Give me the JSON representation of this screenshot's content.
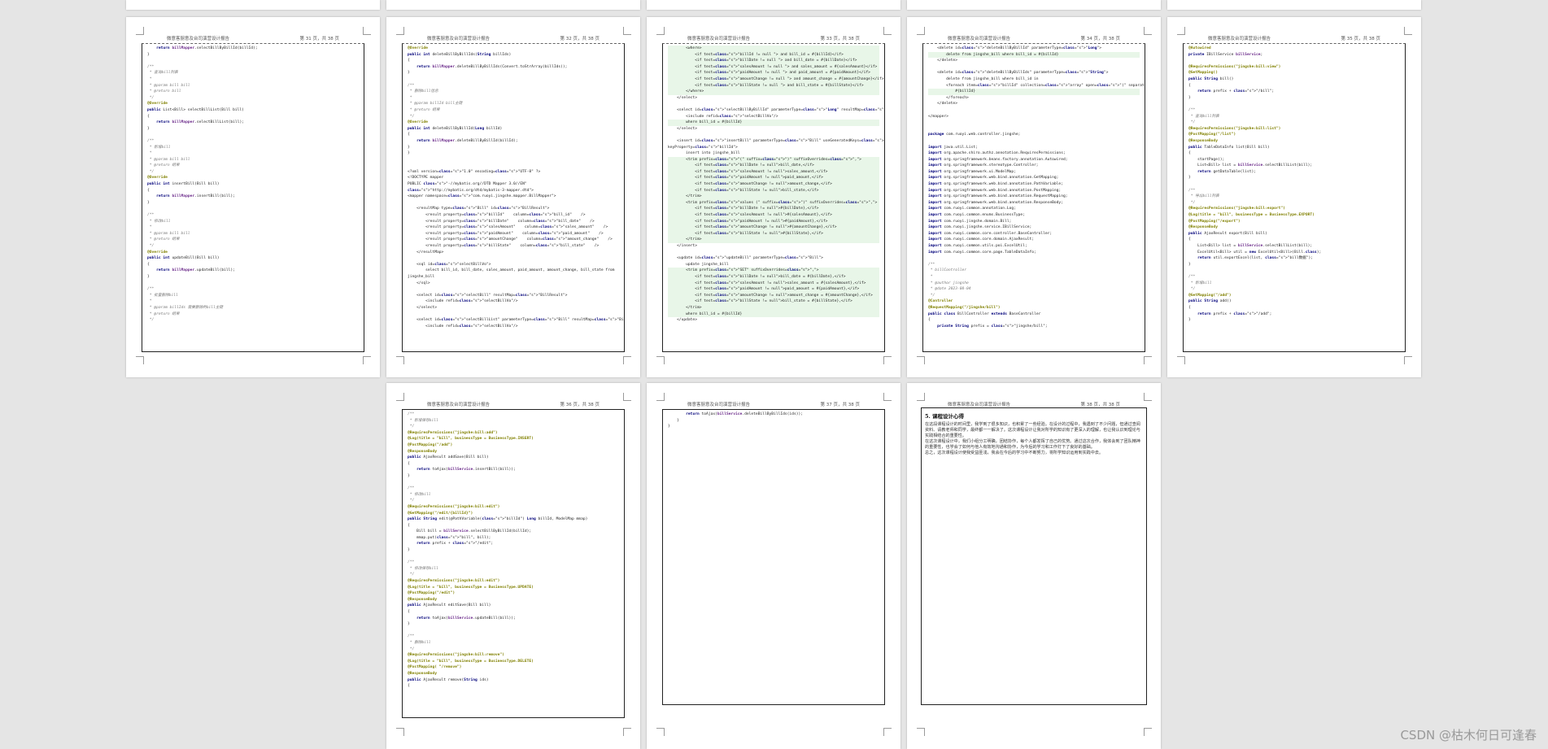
{
  "document": {
    "header_title": "微意客厨意及台司演营设计报告",
    "watermark": "CSDN @枯木何日可逢春"
  },
  "pages": [
    {
      "page_label": "第 31 页，共 38 页",
      "lines": [
        "    return billMapper.selectBillByBillId(billId);",
        "}",
        "",
        "/**",
        " * 查询bill列表",
        " *",
        " * @param bill bill",
        " * @return bill",
        " */",
        "@Override",
        "public List<Bill> selectBillList(Bill bill)",
        "{",
        "    return billMapper.selectBillList(bill);",
        "}",
        "",
        "/**",
        " * 新增bill",
        " *",
        " * @param bill bill",
        " * @return 结果",
        " */",
        "@Override",
        "public int insertBill(Bill bill)",
        "{",
        "    return billMapper.insertBill(bill);",
        "}",
        "",
        "/**",
        " * 修改bill",
        " *",
        " * @param bill bill",
        " * @return 结果",
        " */",
        "@Override",
        "public int updateBill(Bill bill)",
        "{",
        "    return billMapper.updateBill(bill);",
        "}",
        "",
        "/**",
        " * 批量删除bill",
        " *",
        " * @param billIds 需要删除的bill主键",
        " * @return 结果",
        " */"
      ]
    },
    {
      "page_label": "第 32 页，共 38 页",
      "lines": [
        "@Override",
        "public int deleteBillByBillIds(String billIds)",
        "{",
        "    return billMapper.deleteBillByBillIds(Convert.toStrArray(billIds));",
        "}",
        "",
        "/**",
        " * 删除bill信息",
        " *",
        " * @param billId bill主键",
        " * @return 结果",
        " */",
        "@Override",
        "public int deleteBillByBillId(Long billId)",
        "{",
        "    return billMapper.deleteBillByBillId(billId);",
        "}",
        "}",
        "",
        "",
        "<?xml version=\"1.0\" encoding=\"UTF-8\" ?>",
        "<!DOCTYPE mapper",
        "PUBLIC \"-//mybatis.org//DTD Mapper 3.0//EN\"",
        "\"http://mybatis.org/dtd/mybatis-3-mapper.dtd\">",
        "<mapper namespace=\"com.ruoyi.jingshe.mapper.BillMapper\">",
        "",
        "    <resultMap type=\"Bill\" id=\"BillResult\">",
        "        <result property=\"billId\"    column=\"bill_id\"    />",
        "        <result property=\"billDate\"    column=\"bill_date\"    />",
        "        <result property=\"salesAmount\"    column=\"sales_amount\"    />",
        "        <result property=\"paidAmount\"    column=\"paid_amount\"    />",
        "        <result property=\"amountChange\"    column=\"amount_change\"    />",
        "        <result property=\"billState\"    column=\"bill_state\"    />",
        "    </resultMap>",
        "",
        "    <sql id=\"selectBillVo\">",
        "        select bill_id, bill_date, sales_amount, paid_amount, amount_change, bill_state from",
        "jingshe_bill",
        "    </sql>",
        "",
        "    <select id=\"selectBill\" resultMap=\"BillResult\">",
        "        <include refid=\"selectBillVo\"/>",
        "    </select>",
        "",
        "    <select id=\"selectBillList\" parameterType=\"Bill\" resultMap=\"BillResult\">",
        "        <include refid=\"selectBillVo\"/>"
      ]
    },
    {
      "page_label": "第 33 页，共 38 页",
      "lines": [
        "        <where>",
        "            <if test=\"billId != null \"> and bill_id = #{billId}</if>",
        "            <if test=\"billDate != null \"> and bill_date = #{billDate}</if>",
        "            <if test=\"salesAmount != null \"> and sales_amount = #{salesAmount}</if>",
        "            <if test=\"paidAmount != null \"> and paid_amount = #{paidAmount}</if>",
        "            <if test=\"amountChange != null \"> and amount_change = #{amountChange}</if>",
        "            <if test=\"billState != null \"> and bill_state = #{billState}</if>",
        "        </where>",
        "    </select>",
        "",
        "    <select id=\"selectBillByBillId\" parameterType=\"Long\" resultMap=\"BillResult\">",
        "        <include refid=\"selectBillVo\"/>",
        "        where bill_id = #{billId}",
        "    </select>",
        "",
        "    <insert id=\"insertBill\" parameterType=\"Bill\" useGeneratedKeys=\"true\"",
        "keyProperty=\"billId\">",
        "        insert into jingshe_bill",
        "        <trim prefix=\"(\" suffix=\")\" suffixOverrides=\",\">",
        "            <if test=\"billDate != null\">bill_date,</if>",
        "            <if test=\"salesAmount != null\">sales_amount,</if>",
        "            <if test=\"paidAmount != null\">paid_amount,</if>",
        "            <if test=\"amountChange != null\">amount_change,</if>",
        "            <if test=\"billState != null\">bill_state,</if>",
        "        </trim>",
        "        <trim prefix=\"values (\" suffix=\")\" suffixOverrides=\",\">",
        "            <if test=\"billDate != null\">#{billDate},</if>",
        "            <if test=\"salesAmount != null\">#{salesAmount},</if>",
        "            <if test=\"paidAmount != null\">#{paidAmount},</if>",
        "            <if test=\"amountChange != null\">#{amountChange},</if>",
        "            <if test=\"billState != null\">#{billState},</if>",
        "        </trim>",
        "    </insert>",
        "",
        "    <update id=\"updateBill\" parameterType=\"Bill\">",
        "        update jingshe_bill",
        "        <trim prefix=\"SET\" suffixOverrides=\",\">",
        "            <if test=\"billDate != null\">bill_date = #{billDate},</if>",
        "            <if test=\"salesAmount != null\">sales_amount = #{salesAmount},</if>",
        "            <if test=\"paidAmount != null\">paid_amount = #{paidAmount},</if>",
        "            <if test=\"amountChange != null\">amount_change = #{amountChange},</if>",
        "            <if test=\"billState != null\">bill_state = #{billState},</if>",
        "        </trim>",
        "        where bill_id = #{billId}",
        "    </update>"
      ]
    },
    {
      "page_label": "第 34 页，共 38 页",
      "lines": [
        "    <delete id=\"deleteBillByBillId\" parameterType=\"Long\">",
        "        delete from jingshe_bill where bill_id = #{billId}",
        "    </delete>",
        "",
        "    <delete id=\"deleteBillByBillIds\" parameterType=\"String\">",
        "        delete from jingshe_bill where bill_id in",
        "        <foreach item=\"billId\" collection=\"array\" open=\"(\" separator=\",\" close=\")\">",
        "            #{billId}",
        "        </foreach>",
        "    </delete>",
        "",
        "</mapper>",
        "",
        "",
        "package com.ruoyi.web.controller.jingshe;",
        "",
        "import java.util.List;",
        "import org.apache.shiro.authz.annotation.RequiresPermissions;",
        "import org.springframework.beans.factory.annotation.Autowired;",
        "import org.springframework.stereotype.Controller;",
        "import org.springframework.ui.ModelMap;",
        "import org.springframework.web.bind.annotation.GetMapping;",
        "import org.springframework.web.bind.annotation.PathVariable;",
        "import org.springframework.web.bind.annotation.PostMapping;",
        "import org.springframework.web.bind.annotation.RequestMapping;",
        "import org.springframework.web.bind.annotation.ResponseBody;",
        "import com.ruoyi.common.annotation.Log;",
        "import com.ruoyi.common.enums.BusinessType;",
        "import com.ruoyi.jingshe.domain.Bill;",
        "import com.ruoyi.jingshe.service.IBillService;",
        "import com.ruoyi.common.core.controller.BaseController;",
        "import com.ruoyi.common.core.domain.AjaxResult;",
        "import com.ruoyi.common.utils.poi.ExcelUtil;",
        "import com.ruoyi.common.core.page.TableDataInfo;",
        "",
        "/**",
        " * billController",
        " *",
        " * @author jingshe",
        " * @date 2023-08-04",
        " */",
        "@Controller",
        "@RequestMapping(\"/jingshe/bill\")",
        "public class BillController extends BaseController",
        "{",
        "    private String prefix = \"jingshe/bill\";"
      ]
    },
    {
      "page_label": "第 35 页，共 38 页",
      "lines": [
        "@Autowired",
        "private IBillService billService;",
        "",
        "@RequiresPermissions(\"jingshe:bill:view\")",
        "@GetMapping()",
        "public String bill()",
        "{",
        "    return prefix + \"/bill\";",
        "}",
        "",
        "/**",
        " * 查询bill列表",
        " */",
        "@RequiresPermissions(\"jingshe:bill:list\")",
        "@PostMapping(\"/list\")",
        "@ResponseBody",
        "public TableDataInfo list(Bill bill)",
        "{",
        "    startPage();",
        "    List<Bill> list = billService.selectBillList(bill);",
        "    return getDataTable(list);",
        "}",
        "",
        "/**",
        " * 导出bill列表",
        " */",
        "@RequiresPermissions(\"jingshe:bill:export\")",
        "@Log(title = \"bill\", businessType = BusinessType.EXPORT)",
        "@PostMapping(\"/export\")",
        "@ResponseBody",
        "public AjaxResult export(Bill bill)",
        "{",
        "    List<Bill> list = billService.selectBillList(bill);",
        "    ExcelUtil<Bill> util = new ExcelUtil<Bill>(Bill.class);",
        "    return util.exportExcel(list, \"bill数据\");",
        "}",
        "",
        "/**",
        " * 新增bill",
        " */",
        "@GetMapping(\"/add\")",
        "public String add()",
        "{",
        "    return prefix + \"/add\";",
        "}"
      ]
    },
    {
      "page_label": "第 36 页，共 38 页",
      "lines": [
        "/**",
        " * 新增保存bill",
        " */",
        "@RequiresPermissions(\"jingshe:bill:add\")",
        "@Log(title = \"bill\", businessType = BusinessType.INSERT)",
        "@PostMapping(\"/add\")",
        "@ResponseBody",
        "public AjaxResult addSave(Bill bill)",
        "{",
        "    return toAjax(billService.insertBill(bill));",
        "}",
        "",
        "/**",
        " * 修改bill",
        " */",
        "@RequiresPermissions(\"jingshe:bill:edit\")",
        "@GetMapping(\"/edit/{billId}\")",
        "public String edit(@PathVariable(\"billId\") Long billId, ModelMap mmap)",
        "{",
        "    Bill bill = billService.selectBillByBillId(billId);",
        "    mmap.put(\"bill\", bill);",
        "    return prefix + \"/edit\";",
        "}",
        "",
        "/**",
        " * 修改保存bill",
        " */",
        "@RequiresPermissions(\"jingshe:bill:edit\")",
        "@Log(title = \"bill\", businessType = BusinessType.UPDATE)",
        "@PostMapping(\"/edit\")",
        "@ResponseBody",
        "public AjaxResult editSave(Bill bill)",
        "{",
        "    return toAjax(billService.updateBill(bill));",
        "}",
        "",
        "/**",
        " * 删除bill",
        " */",
        "@RequiresPermissions(\"jingshe:bill:remove\")",
        "@Log(title = \"bill\", businessType = BusinessType.DELETE)",
        "@PostMapping( \"/remove\")",
        "@ResponseBody",
        "public AjaxResult remove(String ids)",
        "{"
      ]
    },
    {
      "page_label": "第 37 页，共 38 页",
      "lines": [
        "        return toAjax(billService.deleteBillByBillIds(ids));",
        "    }",
        "}"
      ]
    },
    {
      "page_label": "第 38 页，共 38 页",
      "heading": "5. 课程设计心得",
      "paragraphs": [
        "在这段课程设计的时间里，我学到了很多知识，也积累了一些经验。在设计的过程中，我遇到了不少问题，但通过查阅资料、请教老师和同学，最终都一一解决了。这次课程设计让我对所学的知识有了更深入的理解，也让我认识到理论与实践相结合的重要性。",
        "在这次课程设计中，我们小组分工明确，团结协作，每个人都发挥了自己的优势。通过这次合作，我体会到了团队精神的重要性，也学会了如何与他人有效地沟通和协作，为今后的学习和工作打下了良好的基础。",
        "总之，这次课程设计使我受益匪浅，我会在今后的学习中不断努力，将所学知识运用到实践中去。"
      ]
    }
  ],
  "top_row_stubs": 5
}
